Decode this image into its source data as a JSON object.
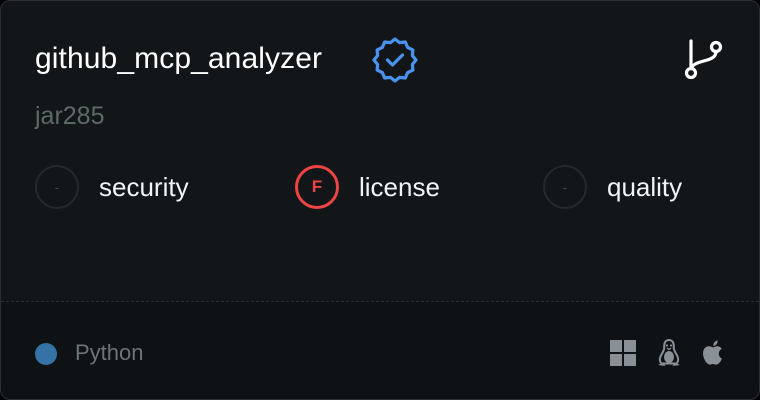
{
  "repo": {
    "name": "github_mcp_analyzer",
    "owner": "jar285",
    "verified_icon": "verified-badge-icon",
    "fork_icon": "git-fork-icon"
  },
  "metrics": [
    {
      "label": "security",
      "grade": "-",
      "status": "none"
    },
    {
      "label": "license",
      "grade": "F",
      "status": "fail"
    },
    {
      "label": "quality",
      "grade": "-",
      "status": "none"
    }
  ],
  "footer": {
    "language": "Python",
    "language_color": "#3572A5",
    "platforms": [
      "windows-icon",
      "linux-icon",
      "apple-icon"
    ]
  },
  "colors": {
    "card_bg": "#121619",
    "accent_blue": "#4a93ef",
    "fail_red": "#ef4444"
  }
}
